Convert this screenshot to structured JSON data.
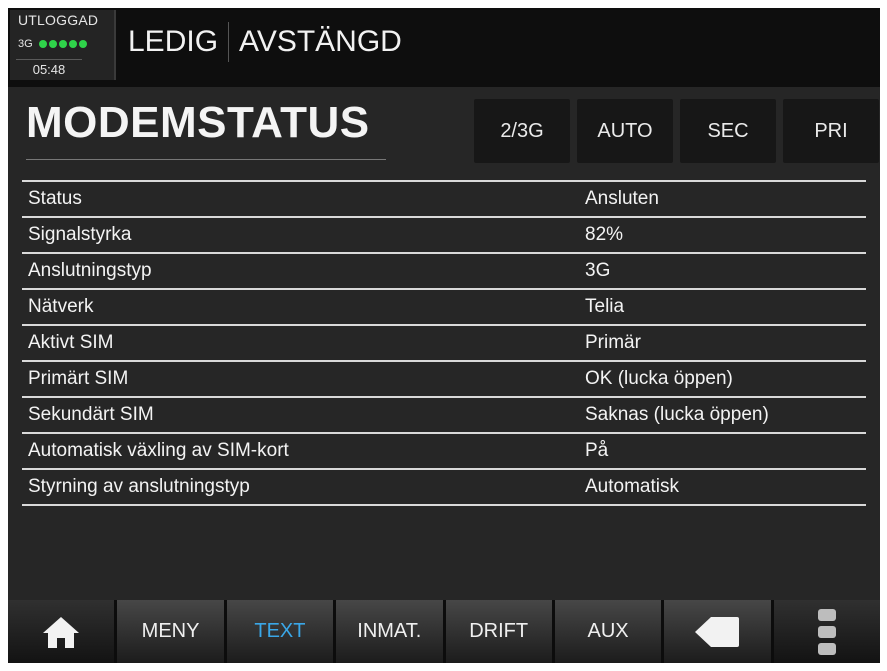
{
  "statusbar": {
    "login_state": "UTLOGGAD",
    "network": "3G",
    "signal_bars": 5,
    "time": "05:48",
    "status_primary": "LEDIG",
    "status_secondary": "AVSTÄNGD"
  },
  "page": {
    "title": "MODEMSTATUS"
  },
  "mode_buttons": [
    "2/3G",
    "AUTO",
    "SEC",
    "PRI"
  ],
  "rows": [
    {
      "label": "Status",
      "value": "Ansluten"
    },
    {
      "label": "Signalstyrka",
      "value": "82%"
    },
    {
      "label": "Anslutningstyp",
      "value": "3G"
    },
    {
      "label": "Nätverk",
      "value": "Telia"
    },
    {
      "label": "Aktivt SIM",
      "value": "Primär"
    },
    {
      "label": "Primärt SIM",
      "value": "OK (lucka öppen)"
    },
    {
      "label": "Sekundärt SIM",
      "value": "Saknas (lucka öppen)"
    },
    {
      "label": "Automatisk växling av SIM-kort",
      "value": "På"
    },
    {
      "label": "Styrning av anslutningstyp",
      "value": "Automatisk"
    }
  ],
  "nav": {
    "home_icon": "home-icon",
    "items": [
      "MENY",
      "TEXT",
      "INMAT.",
      "DRIFT",
      "AUX"
    ],
    "active": "TEXT",
    "back_icon": "back-arrow-icon",
    "more_icon": "more-vertical-icon",
    "active_color": "#3aa7e8"
  },
  "colors": {
    "signal": "#2fd34a",
    "background": "#262626"
  }
}
